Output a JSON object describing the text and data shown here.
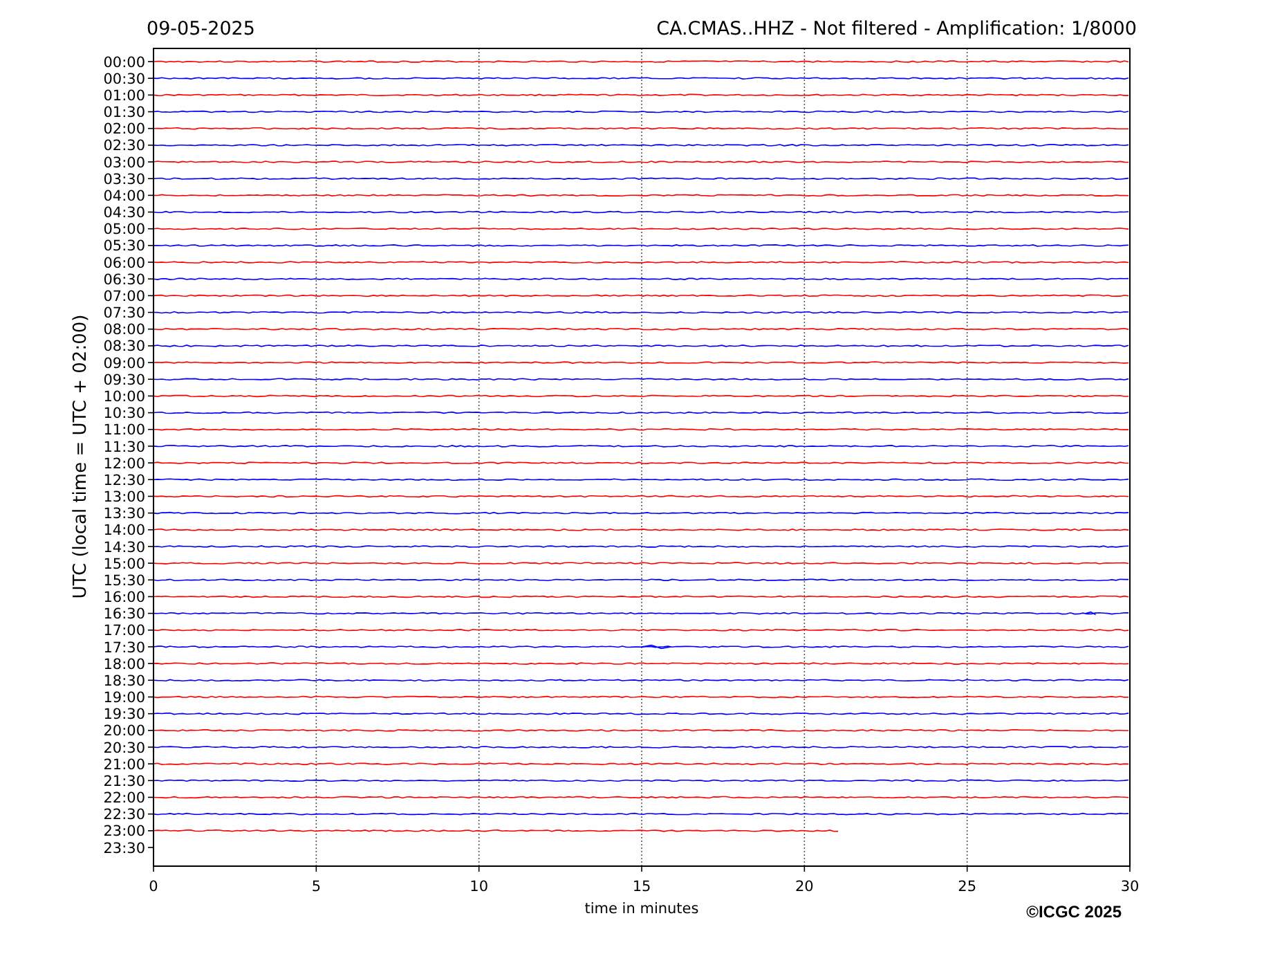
{
  "header": {
    "date": "09-05-2025",
    "title": "CA.CMAS..HHZ - Not filtered - Amplification: 1/8000"
  },
  "plot": {
    "ylabel": "UTC (local time = UTC + 02:00)",
    "xlabel": "time in minutes",
    "xticks": [
      "0",
      "5",
      "10",
      "15",
      "20",
      "25",
      "30"
    ],
    "rows": [
      {
        "label": "00:00",
        "color": "#ff0000",
        "level": 1
      },
      {
        "label": "00:30",
        "color": "#0000ff",
        "level": 1
      },
      {
        "label": "01:00",
        "color": "#ff0000",
        "level": 1
      },
      {
        "label": "01:30",
        "color": "#0000ff",
        "level": 1
      },
      {
        "label": "02:00",
        "color": "#ff0000",
        "level": 1
      },
      {
        "label": "02:30",
        "color": "#0000ff",
        "level": 1
      },
      {
        "label": "03:00",
        "color": "#ff0000",
        "level": 1
      },
      {
        "label": "03:30",
        "color": "#0000ff",
        "level": 1
      },
      {
        "label": "04:00",
        "color": "#ff0000",
        "level": 1
      },
      {
        "label": "04:30",
        "color": "#0000ff",
        "level": 1
      },
      {
        "label": "05:00",
        "color": "#ff0000",
        "level": 1
      },
      {
        "label": "05:30",
        "color": "#0000ff",
        "level": 1
      },
      {
        "label": "06:00",
        "color": "#ff0000",
        "level": 1
      },
      {
        "label": "06:30",
        "color": "#0000ff",
        "level": 1
      },
      {
        "label": "07:00",
        "color": "#ff0000",
        "level": 1
      },
      {
        "label": "07:30",
        "color": "#0000ff",
        "level": 1
      },
      {
        "label": "08:00",
        "color": "#ff0000",
        "level": 1
      },
      {
        "label": "08:30",
        "color": "#0000ff",
        "level": 1
      },
      {
        "label": "09:00",
        "color": "#ff0000",
        "level": 1
      },
      {
        "label": "09:30",
        "color": "#0000ff",
        "level": 1
      },
      {
        "label": "10:00",
        "color": "#ff0000",
        "level": 1
      },
      {
        "label": "10:30",
        "color": "#0000ff",
        "level": 1
      },
      {
        "label": "11:00",
        "color": "#ff0000",
        "level": 1
      },
      {
        "label": "11:30",
        "color": "#0000ff",
        "level": 1
      },
      {
        "label": "12:00",
        "color": "#ff0000",
        "level": 1
      },
      {
        "label": "12:30",
        "color": "#0000ff",
        "level": 1
      },
      {
        "label": "13:00",
        "color": "#ff0000",
        "level": 1
      },
      {
        "label": "13:30",
        "color": "#0000ff",
        "level": 1
      },
      {
        "label": "14:00",
        "color": "#ff0000",
        "level": 1
      },
      {
        "label": "14:30",
        "color": "#0000ff",
        "level": 1
      },
      {
        "label": "15:00",
        "color": "#ff0000",
        "level": 1
      },
      {
        "label": "15:30",
        "color": "#0000ff",
        "level": 1
      },
      {
        "label": "16:00",
        "color": "#ff0000",
        "level": 1
      },
      {
        "label": "16:30",
        "color": "#0000ff",
        "level": 1
      },
      {
        "label": "17:00",
        "color": "#ff0000",
        "level": 1
      },
      {
        "label": "17:30",
        "color": "#0000ff",
        "level": 1
      },
      {
        "label": "18:00",
        "color": "#ff0000",
        "level": 1
      },
      {
        "label": "18:30",
        "color": "#0000ff",
        "level": 1
      },
      {
        "label": "19:00",
        "color": "#ff0000",
        "level": 1
      },
      {
        "label": "19:30",
        "color": "#0000ff",
        "level": 1
      },
      {
        "label": "20:00",
        "color": "#ff0000",
        "level": 1
      },
      {
        "label": "20:30",
        "color": "#0000ff",
        "level": 1
      },
      {
        "label": "21:00",
        "color": "#ff0000",
        "level": 1
      },
      {
        "label": "21:30",
        "color": "#0000ff",
        "level": 1
      },
      {
        "label": "22:00",
        "color": "#ff0000",
        "level": 1
      },
      {
        "label": "22:30",
        "color": "#0000ff",
        "level": 1
      },
      {
        "label": "23:00",
        "color": "#ff0000",
        "level": 0.703
      },
      {
        "label": "23:30"
      }
    ]
  },
  "copyright": "©ICGC 2025"
}
